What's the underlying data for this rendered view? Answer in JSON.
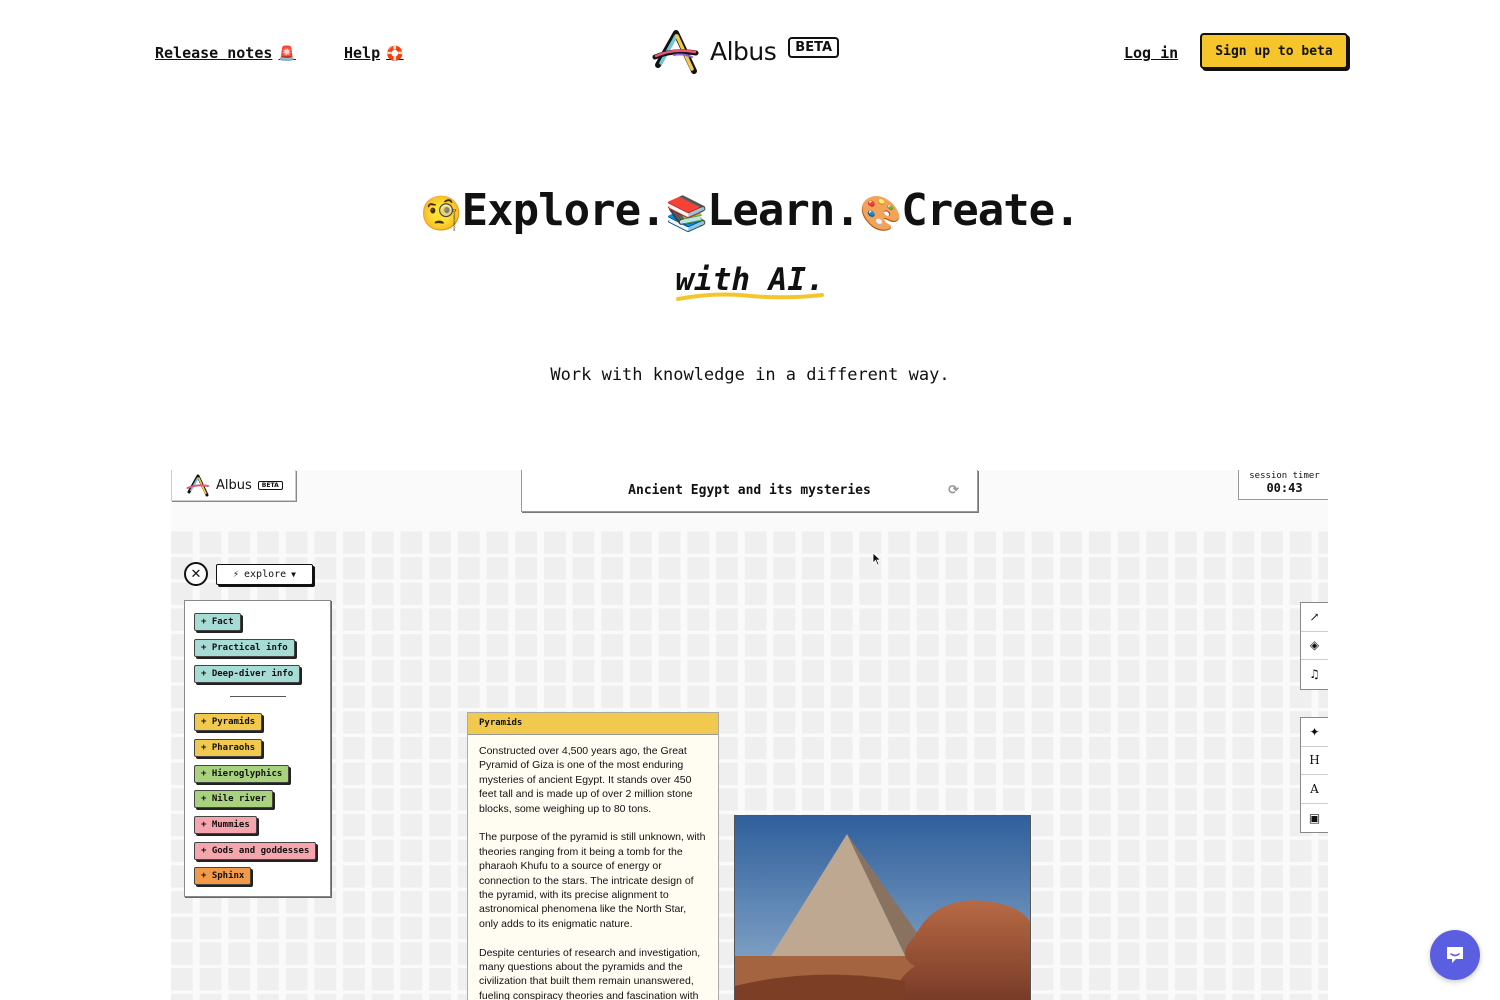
{
  "header": {
    "release_notes": "Release notes",
    "release_notes_icon": "🚨",
    "help": "Help",
    "help_icon": "🛟",
    "logo_text": "Albus",
    "beta": "BETA",
    "login": "Log in",
    "signup": "Sign up to beta"
  },
  "hero": {
    "explore_emoji": "🧐",
    "explore": "Explore.",
    "learn_emoji": "📚",
    "learn": "Learn.",
    "create_emoji": "🎨",
    "create": "Create.",
    "with_ai": "with AI.",
    "tagline": "Work with knowledge in a different way."
  },
  "preview": {
    "logo_text": "Albus",
    "beta": "BETA",
    "topic": "Ancient Egypt and its mysteries",
    "timer_label": "session timer",
    "timer_value": "00:43",
    "mode": "explore",
    "chips": [
      {
        "label": "+ Fact",
        "color": "#a7dcd4"
      },
      {
        "label": "+ Practical info",
        "color": "#a7dcd4"
      },
      {
        "label": "+ Deep-diver info",
        "color": "#a7dcd4"
      },
      {
        "label": "+ Pyramids",
        "color": "#f0c94e"
      },
      {
        "label": "+ Pharaohs",
        "color": "#f0c94e"
      },
      {
        "label": "+ Hieroglyphics",
        "color": "#a9d27f"
      },
      {
        "label": "+ Nile river",
        "color": "#a9d27f"
      },
      {
        "label": "+ Mummies",
        "color": "#f5a5ad"
      },
      {
        "label": "+ Gods and goddesses",
        "color": "#f5a5ad"
      },
      {
        "label": "+ Sphinx",
        "color": "#f39a4a"
      }
    ],
    "card": {
      "title": "Pyramids",
      "p1": "Constructed over 4,500 years ago, the Great Pyramid of Giza is one of the most enduring mysteries of ancient Egypt. It stands over 450 feet tall and is made up of over 2 million stone blocks, some weighing up to 80 tons.",
      "p2": "The purpose of the pyramid is still unknown, with theories ranging from it being a tomb for the pharaoh Khufu to a source of energy or connection to the stars. The intricate design of the pyramid, with its precise alignment to astronomical phenomena like the North Star, only adds to its enigmatic nature.",
      "p3": "Despite centuries of research and investigation, many questions about the pyramids and the civilization that built them remain unanswered, fueling conspiracy theories and fascination with"
    },
    "tools_top": [
      "share-icon",
      "eraser-icon",
      "music-icon"
    ],
    "tools_bottom": [
      "magic-wand-icon",
      "heading-icon",
      "text-icon",
      "image-icon"
    ],
    "tool_heading_glyph": "H",
    "tool_text_glyph": "A"
  }
}
